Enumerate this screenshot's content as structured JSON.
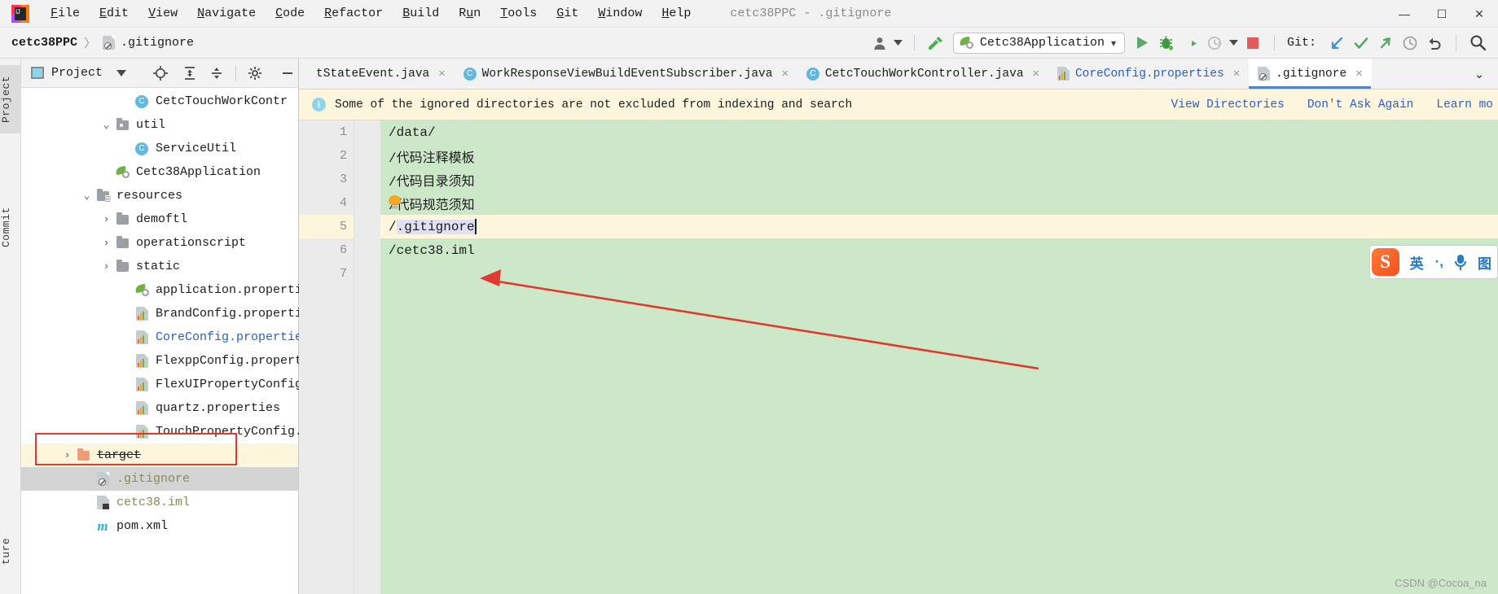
{
  "window": {
    "title": "cetc38PPC - .gitignore",
    "controls": {
      "minimize": "—",
      "maximize": "☐",
      "close": "✕"
    }
  },
  "menubar": {
    "items": [
      {
        "label": "File",
        "mnemonic": "F"
      },
      {
        "label": "Edit",
        "mnemonic": "E"
      },
      {
        "label": "View",
        "mnemonic": "V"
      },
      {
        "label": "Navigate",
        "mnemonic": "N"
      },
      {
        "label": "Code",
        "mnemonic": "C"
      },
      {
        "label": "Refactor",
        "mnemonic": "R"
      },
      {
        "label": "Build",
        "mnemonic": "B"
      },
      {
        "label": "Run",
        "mnemonic": "u"
      },
      {
        "label": "Tools",
        "mnemonic": "T"
      },
      {
        "label": "Git",
        "mnemonic": "G"
      },
      {
        "label": "Window",
        "mnemonic": "W"
      },
      {
        "label": "Help",
        "mnemonic": "H"
      }
    ]
  },
  "toolbar": {
    "breadcrumb": {
      "project": "cetc38PPC",
      "separator": "〉",
      "file": ".gitignore"
    },
    "run_config": {
      "label": "Cetc38Application",
      "chevron": "▾"
    },
    "git_label": "Git:",
    "icons": [
      "user-avatar-icon",
      "hammer-build-icon",
      "run-icon",
      "debug-icon",
      "run-with-coverage-icon",
      "profiler-icon",
      "stop-icon",
      "git-update-icon",
      "git-commit-icon",
      "git-push-icon",
      "history-icon",
      "revert-icon",
      "search-everywhere-icon"
    ]
  },
  "rail": {
    "tabs": [
      {
        "label": "Project",
        "selected": true
      },
      {
        "label": "Commit",
        "selected": false
      },
      {
        "label": "ture",
        "selected": false
      }
    ]
  },
  "project_panel": {
    "title": "Project",
    "header_icons": [
      "project-view-icon",
      "chevron-down-icon",
      "locate-icon",
      "expand-all-icon",
      "collapse-all-icon",
      "gear-icon",
      "hide-icon"
    ],
    "tree": [
      {
        "label": "CetcTouchWorkContr",
        "icon": "java-class-icon",
        "indent": 5,
        "arrow": "",
        "style": "normal"
      },
      {
        "label": "util",
        "icon": "source-folder-icon",
        "indent": 4,
        "arrow": "⌄",
        "style": "normal"
      },
      {
        "label": "ServiceUtil",
        "icon": "java-class-icon",
        "indent": 5,
        "arrow": "",
        "style": "normal"
      },
      {
        "label": "Cetc38Application",
        "icon": "spring-boot-icon",
        "indent": 4,
        "arrow": "",
        "style": "normal"
      },
      {
        "label": "resources",
        "icon": "resource-folder-icon",
        "indent": 3,
        "arrow": "⌄",
        "style": "normal"
      },
      {
        "label": "demoftl",
        "icon": "folder-icon",
        "indent": 4,
        "arrow": "›",
        "style": "normal"
      },
      {
        "label": "operationscript",
        "icon": "folder-icon",
        "indent": 4,
        "arrow": "›",
        "style": "normal"
      },
      {
        "label": "static",
        "icon": "folder-icon",
        "indent": 4,
        "arrow": "›",
        "style": "normal"
      },
      {
        "label": "application.properties",
        "icon": "spring-config-icon",
        "indent": 5,
        "arrow": "",
        "style": "normal"
      },
      {
        "label": "BrandConfig.properties",
        "icon": "properties-file-icon",
        "indent": 5,
        "arrow": "",
        "style": "normal"
      },
      {
        "label": "CoreConfig.properties",
        "icon": "properties-file-icon",
        "indent": 5,
        "arrow": "",
        "style": "blue"
      },
      {
        "label": "FlexppConfig.properties",
        "icon": "properties-file-icon",
        "indent": 5,
        "arrow": "",
        "style": "normal"
      },
      {
        "label": "FlexUIPropertyConfig.prop",
        "icon": "properties-file-icon",
        "indent": 5,
        "arrow": "",
        "style": "normal"
      },
      {
        "label": "quartz.properties",
        "icon": "properties-file-icon",
        "indent": 5,
        "arrow": "",
        "style": "normal"
      },
      {
        "label": "TouchPropertyConfig.prope",
        "icon": "properties-file-icon",
        "indent": 5,
        "arrow": "",
        "style": "normal"
      },
      {
        "label": "target",
        "icon": "excluded-folder-icon",
        "indent": 2,
        "arrow": "›",
        "style": "strikethrough"
      },
      {
        "label": ".gitignore",
        "icon": "gitignore-file-icon",
        "indent": 3,
        "arrow": "",
        "style": "selected"
      },
      {
        "label": "cetc38.iml",
        "icon": "iml-file-icon",
        "indent": 3,
        "arrow": "",
        "style": "ignored"
      },
      {
        "label": "pom.xml",
        "icon": "maven-icon",
        "indent": 3,
        "arrow": "",
        "style": "normal"
      }
    ]
  },
  "editor": {
    "tabs": [
      {
        "label": "tStateEvent.java",
        "icon": "",
        "active": false,
        "close": "✕"
      },
      {
        "label": "WorkResponseViewBuildEventSubscriber.java",
        "icon": "java-class-icon",
        "active": false,
        "close": "✕"
      },
      {
        "label": "CetcTouchWorkController.java",
        "icon": "java-class-icon",
        "active": false,
        "close": "✕"
      },
      {
        "label": "CoreConfig.properties",
        "icon": "properties-file-icon",
        "active": false,
        "close": "✕"
      },
      {
        "label": ".gitignore",
        "icon": "gitignore-file-icon",
        "active": true,
        "close": "✕"
      }
    ],
    "tabs_overflow": "⌄",
    "notification": {
      "icon": "info-icon",
      "message": "Some of the ignored directories are not excluded from indexing and search",
      "links": [
        "View Directories",
        "Don't Ask Again",
        "Learn mo"
      ]
    },
    "lines": [
      {
        "no": "1",
        "text": "/data/",
        "current": false,
        "fold": true
      },
      {
        "no": "2",
        "text": "/代码注释模板",
        "current": false,
        "fold": false
      },
      {
        "no": "3",
        "text": "/代码目录须知",
        "current": false,
        "fold": false
      },
      {
        "no": "4",
        "text": "/代码规范须知",
        "current": false,
        "fold": false,
        "bulb": true
      },
      {
        "no": "5",
        "text": "/.gitignore",
        "current": true,
        "fold": false,
        "caret": true,
        "highlight": ".gitignore"
      },
      {
        "no": "6",
        "text": "/cetc38.iml",
        "current": false,
        "fold": false
      },
      {
        "no": "7",
        "text": "",
        "current": false,
        "fold": false
      }
    ],
    "background_color": "#cde8c8",
    "current_line_color": "#fdf6dd"
  },
  "ime": {
    "logo": "S",
    "mode": "英",
    "punct": "·,",
    "mic": "microphone-icon",
    "more": "图"
  },
  "watermark": "CSDN @Cocoa_na",
  "annotations": {
    "arrow_color": "#e03a30",
    "box_color": "#e03a30"
  }
}
